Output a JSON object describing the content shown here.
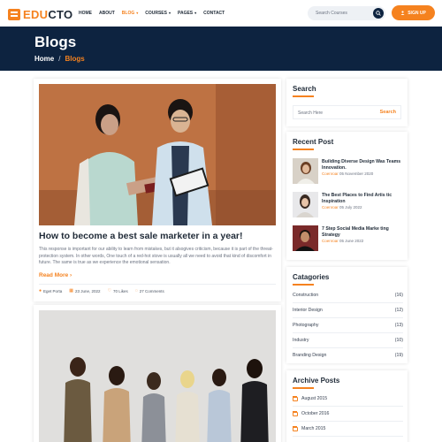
{
  "brand": {
    "name_accent": "EDU",
    "name_rest": "CTO"
  },
  "nav": [
    {
      "label": "HOME",
      "active": false,
      "dropdown": false
    },
    {
      "label": "ABOUT",
      "active": false,
      "dropdown": false
    },
    {
      "label": "BLOG",
      "active": true,
      "dropdown": true
    },
    {
      "label": "COURSES",
      "active": false,
      "dropdown": true
    },
    {
      "label": "PAGES",
      "active": false,
      "dropdown": true
    },
    {
      "label": "CONTACT",
      "active": false,
      "dropdown": false
    }
  ],
  "header_search": {
    "placeholder": "Search Courses",
    "icon": "search-icon"
  },
  "signup": {
    "label": "SIGN UP",
    "icon": "user-icon"
  },
  "banner": {
    "title": "Blogs",
    "breadcrumb": {
      "home": "Home",
      "separator": "/",
      "current": "Blogs"
    }
  },
  "posts": [
    {
      "title": "How to become a best sale marketer in a year!",
      "excerpt": "This response is important for our ability to learn from mistakes, but it alsogives criticism, because it is part of the threat-protection system. In other words, One touch of a red-hot stove is usually all we need to avoid that kind of discomfort in future. The same is true as we experience the emotional sensation.",
      "read_more": "Read More",
      "meta": {
        "author": "Eget Porta",
        "date": "23 June, 2022",
        "likes": "70 Likes",
        "comments": "27 Comments"
      }
    },
    {
      "title": "",
      "excerpt": ""
    }
  ],
  "sidebar": {
    "search": {
      "title": "Search",
      "placeholder": "Search Here",
      "button": "Search"
    },
    "recent": {
      "title": "Recent Post",
      "items": [
        {
          "title": "Building Diverse Design Was Teams Innovation.",
          "by": "Coenroar",
          "date": "05 November 2020"
        },
        {
          "title": "The Best Places to Find Artis tic Inspiration",
          "by": "Coenroar",
          "date": "05 July 2022"
        },
        {
          "title": "7 Step Social Media Marke ting Strategy",
          "by": "Coenroar",
          "date": "05 June 2022"
        }
      ]
    },
    "categories": {
      "title": "Catagories",
      "items": [
        {
          "name": "Construction",
          "count": "(16)"
        },
        {
          "name": "Interior Design",
          "count": "(12)"
        },
        {
          "name": "Photography",
          "count": "(13)"
        },
        {
          "name": "Industry",
          "count": "(10)"
        },
        {
          "name": "Branding Design",
          "count": "(19)"
        }
      ]
    },
    "archive": {
      "title": "Archive Posts",
      "items": [
        {
          "label": "August 2015"
        },
        {
          "label": "October 2016"
        },
        {
          "label": "March 2015"
        }
      ]
    }
  },
  "colors": {
    "accent": "#f5821f",
    "navy": "#0d2340"
  }
}
